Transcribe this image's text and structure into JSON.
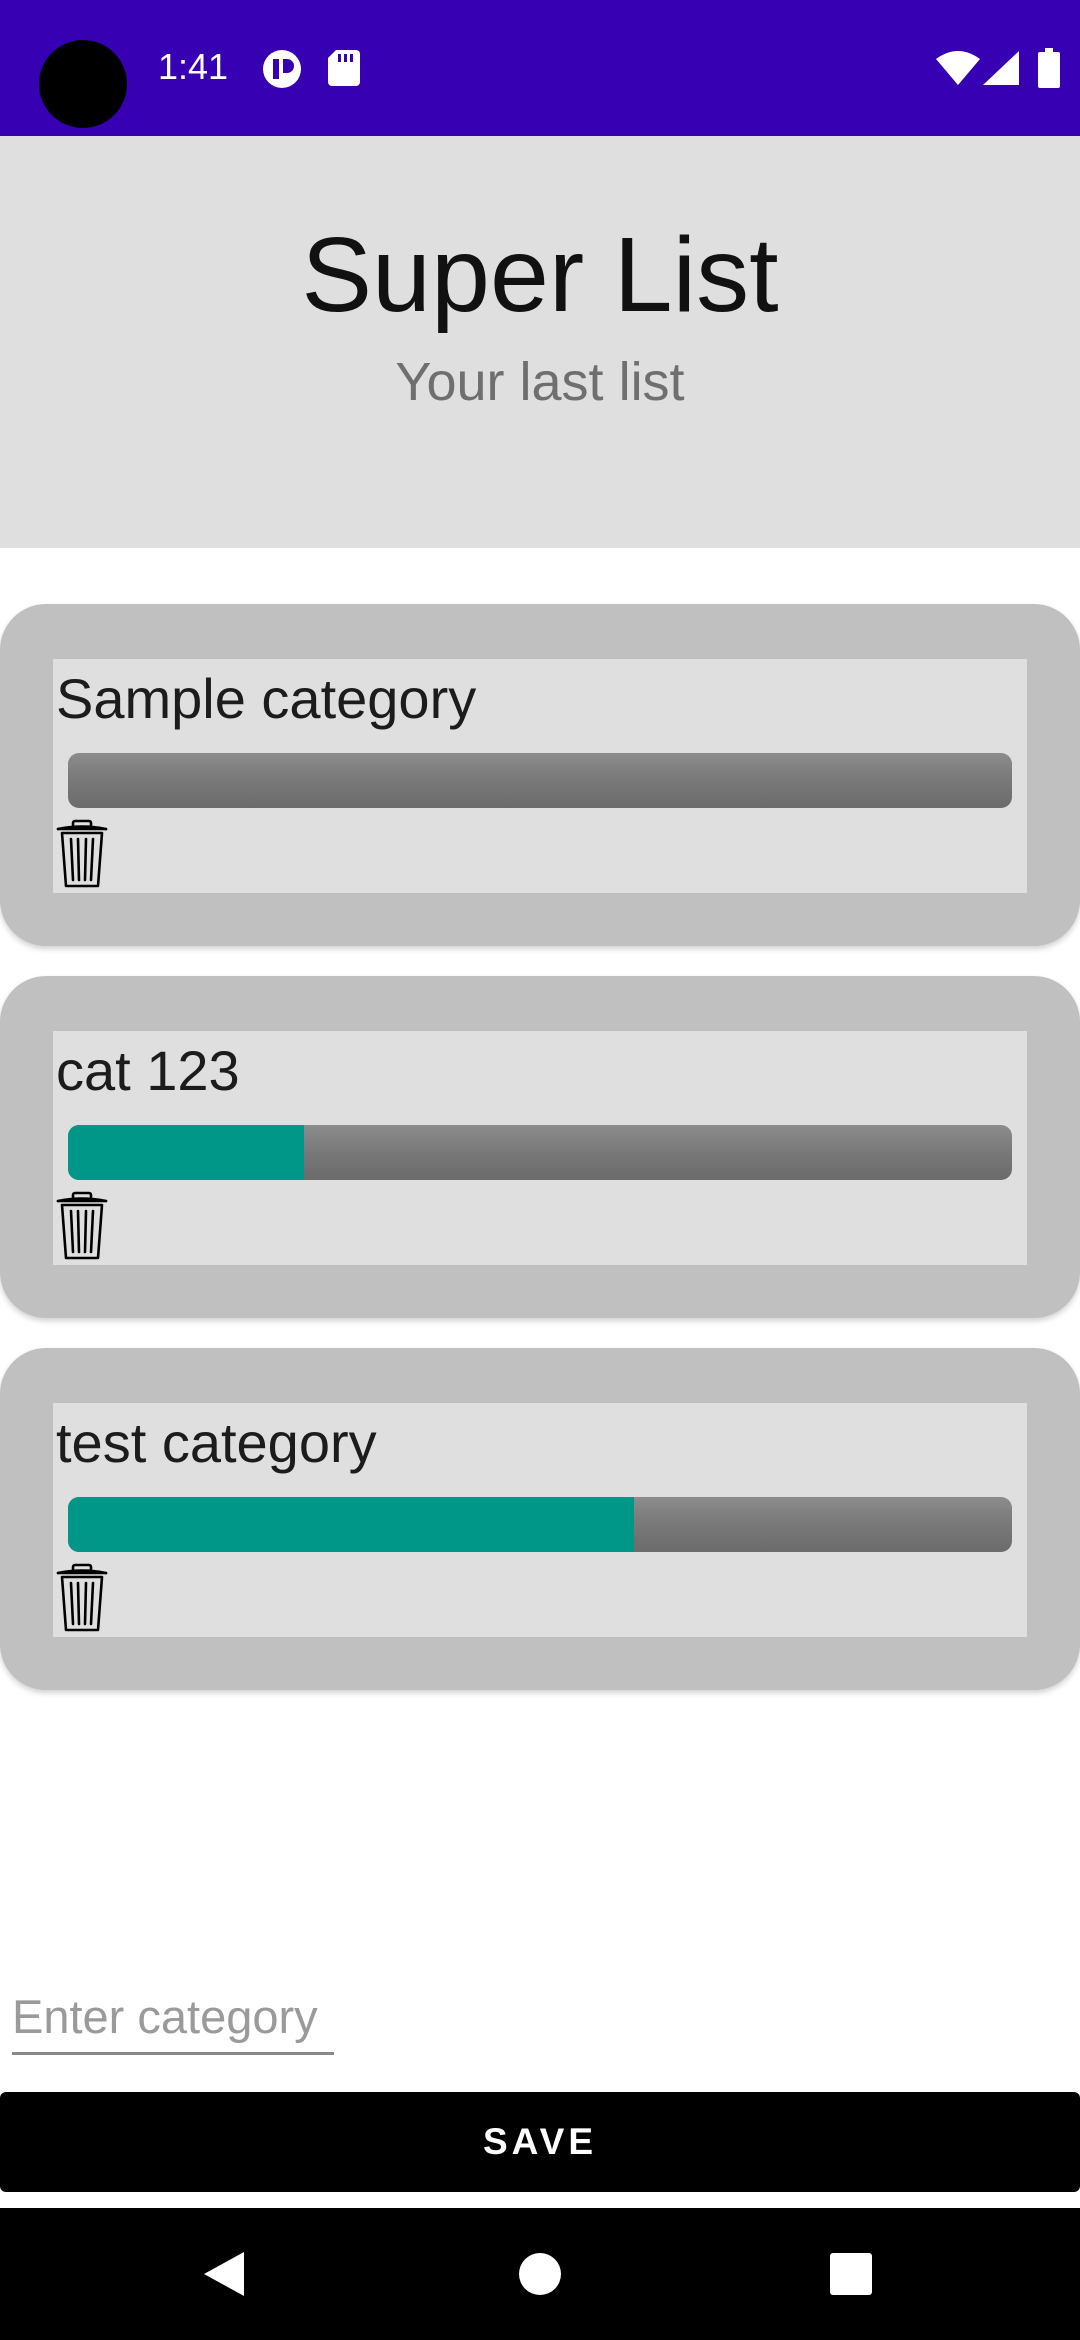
{
  "status_bar": {
    "time": "1:41",
    "icons": [
      "camera-cutout",
      "app-notification-icon",
      "sd-card-icon",
      "wifi-icon",
      "signal-icon",
      "battery-icon"
    ],
    "color": "#3700b3"
  },
  "header": {
    "title": "Super List",
    "subtitle": "Your last list"
  },
  "categories": [
    {
      "name": "Sample category",
      "progress": 0.0
    },
    {
      "name": "cat 123",
      "progress": 0.25
    },
    {
      "name": "test category",
      "progress": 0.6
    }
  ],
  "input": {
    "placeholder": "Enter category",
    "value": ""
  },
  "save_button": {
    "label": "SAVE"
  },
  "nav_bar": {
    "icons": [
      "back-icon",
      "home-icon",
      "recents-icon"
    ]
  },
  "colors": {
    "accent": "#009688",
    "status_bar": "#3700b3",
    "card_outer": "#c0c0c0",
    "card_inner": "#dfdfdf"
  }
}
